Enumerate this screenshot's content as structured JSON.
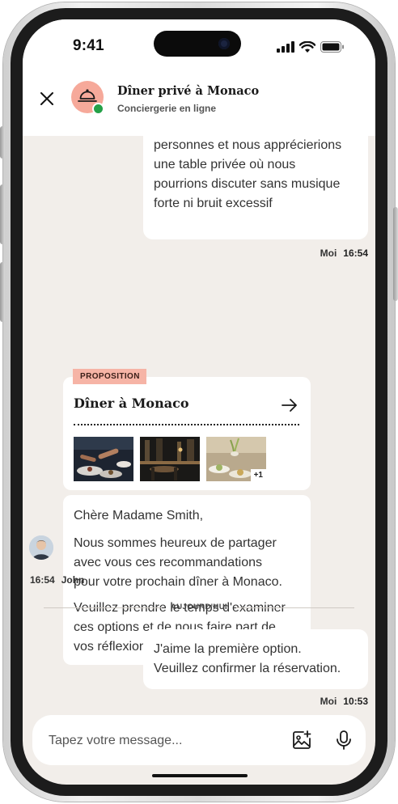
{
  "status_bar": {
    "time": "9:41"
  },
  "header": {
    "title": "Dîner privé à Monaco",
    "subtitle": "Conciergerie en ligne"
  },
  "messages": {
    "first": {
      "lines": [
        "personnes et nous apprécierions",
        "une table privée où nous",
        "pourrions discuter sans musique",
        "forte ni bruit excessif"
      ],
      "sender": "Moi",
      "time": "16:54"
    },
    "proposal": {
      "tag": "PROPOSITION",
      "title": "Dîner à Monaco",
      "more_photos": "+1"
    },
    "john": {
      "greeting": "Chère Madame Smith,",
      "paragraph1": [
        "Nous sommes heureux de partager",
        "avec vous ces recommandations",
        "pour votre prochain dîner à Monaco."
      ],
      "paragraph2": [
        "Veuillez prendre le temps d'examiner",
        "ces options et de nous faire part de",
        "vos réflexions."
      ],
      "time": "16:54",
      "sender": "John"
    },
    "divider": "AUJOURD'HUI",
    "reply": {
      "lines": [
        "J'aime la première option.",
        "Veuillez confirmer la réservation."
      ],
      "sender": "Moi",
      "time": "10:53"
    }
  },
  "composer": {
    "placeholder": "Tapez votre message..."
  },
  "icons": {
    "close": "close-icon",
    "concierge": "service-bell-icon",
    "arrow": "arrow-right-icon",
    "photo": "add-photo-icon",
    "mic": "microphone-icon"
  },
  "colors": {
    "background": "#f2eeea",
    "bubble": "#ffffff",
    "accent": "#f6a99a",
    "tag": "#f6b4a6",
    "online": "#24a148"
  }
}
